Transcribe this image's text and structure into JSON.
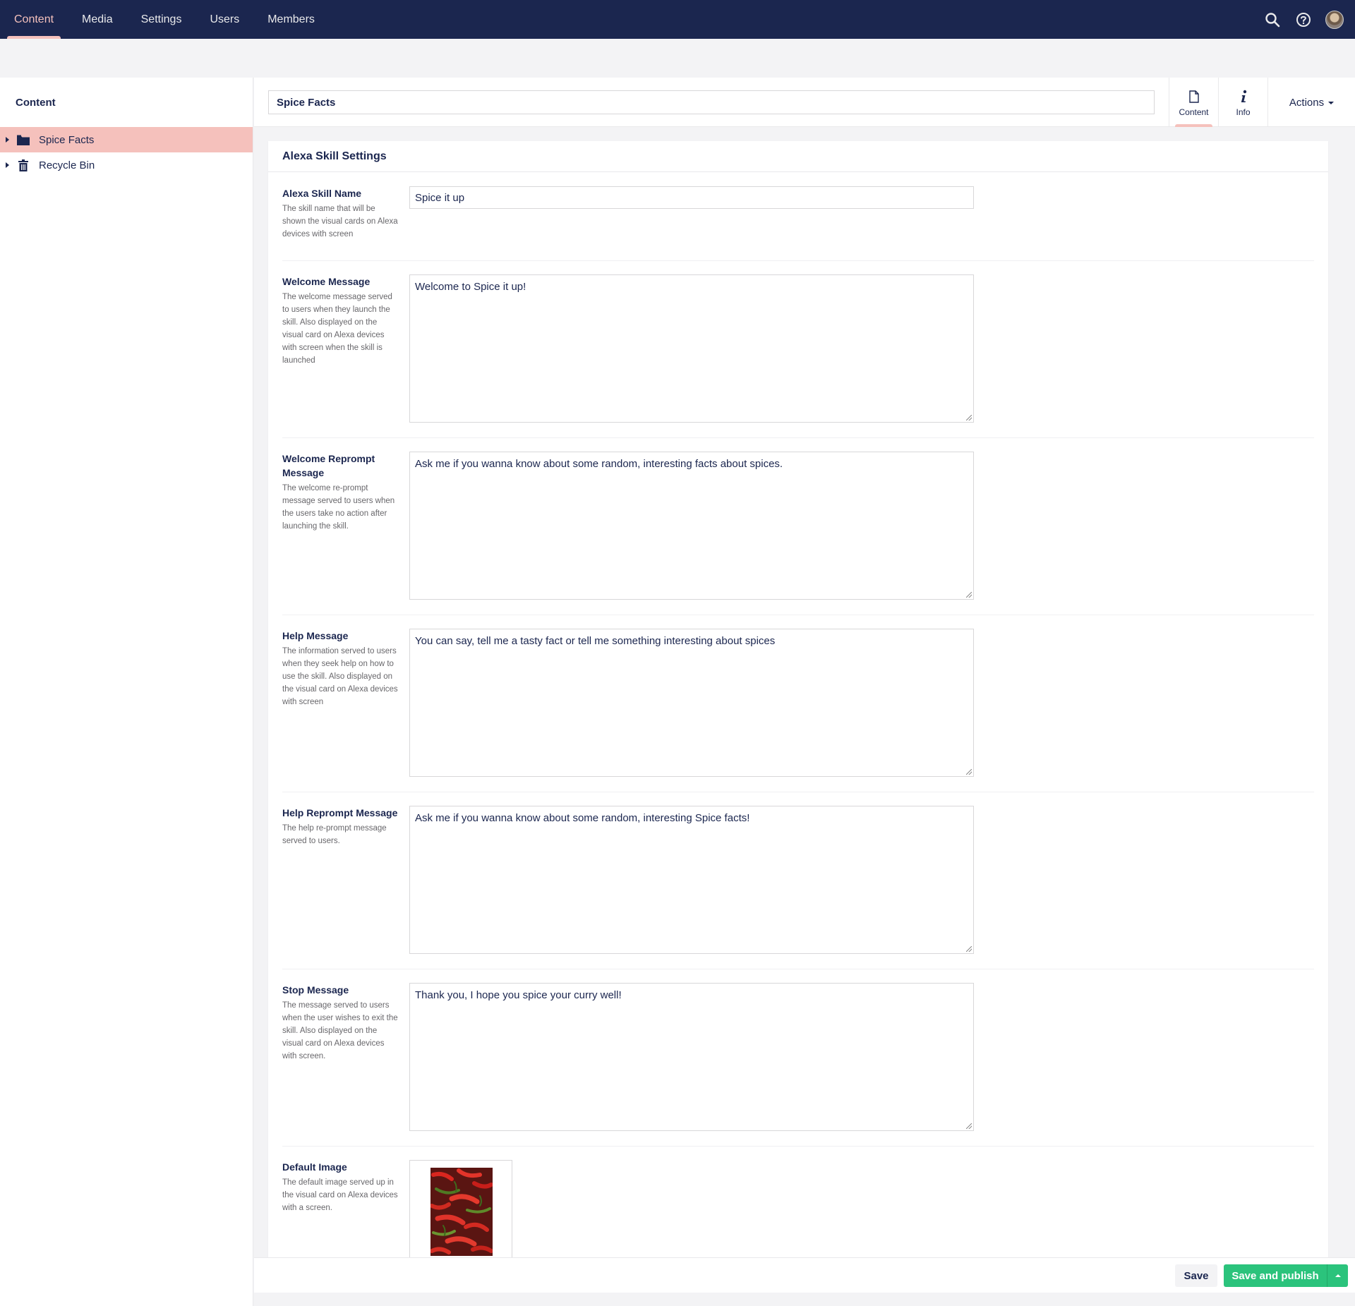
{
  "topnav": {
    "items": [
      {
        "label": "Content",
        "active": true
      },
      {
        "label": "Media"
      },
      {
        "label": "Settings"
      },
      {
        "label": "Users"
      },
      {
        "label": "Members"
      }
    ],
    "tools": [
      "search-icon",
      "help-icon",
      "user-avatar"
    ]
  },
  "sidebar": {
    "title": "Content",
    "tree": [
      {
        "label": "Spice Facts",
        "icon": "folder-icon",
        "selected": true
      },
      {
        "label": "Recycle Bin",
        "icon": "trash-icon"
      }
    ]
  },
  "editor": {
    "node_name": "Spice Facts",
    "apps": [
      {
        "label": "Content",
        "icon": "document-icon",
        "active": true
      },
      {
        "label": "Info",
        "icon": "info-icon"
      }
    ],
    "actions_label": "Actions"
  },
  "group": {
    "title": "Alexa Skill Settings",
    "properties": [
      {
        "label": "Alexa Skill Name",
        "description": "The skill name that will be shown the visual cards on Alexa devices with screen",
        "value": "Spice it up"
      },
      {
        "label": "Welcome Message",
        "description": "The welcome message served to users when they launch the skill. Also displayed on the visual card on Alexa devices with screen when the skill is launched",
        "value": "Welcome to Spice it up!"
      },
      {
        "label": "Welcome Reprompt Message",
        "description": "The welcome re-prompt message served to users when the users take no action after launching the skill.",
        "value": "Ask me if you wanna know about some random, interesting facts about spices."
      },
      {
        "label": "Help Message",
        "description": "The information served to users when they seek help on how to use the skill. Also displayed on the visual card on Alexa devices with screen",
        "value": "You can say, tell me a tasty fact or tell me something interesting about spices"
      },
      {
        "label": "Help Reprompt Message",
        "description": "The help re-prompt message served to users.",
        "value": "Ask me if you wanna know about some random, interesting Spice facts!"
      },
      {
        "label": "Stop Message",
        "description": "The message served to users when the user wishes to exit the skill. Also displayed on the visual card on Alexa devices with screen.",
        "value": "Thank you, I hope you spice your curry well!"
      },
      {
        "label": "Default Image",
        "description": "The default image served up in the visual card on Alexa devices with a screen.",
        "image": "red-chili-peppers-image"
      }
    ]
  },
  "footer": {
    "save_label": "Save",
    "publish_label": "Save and publish"
  },
  "colors": {
    "topbar": "#1b264f",
    "accent": "#f5c1bc",
    "publish": "#2bc37c",
    "text": "#1b264f",
    "muted": "#68676b"
  }
}
